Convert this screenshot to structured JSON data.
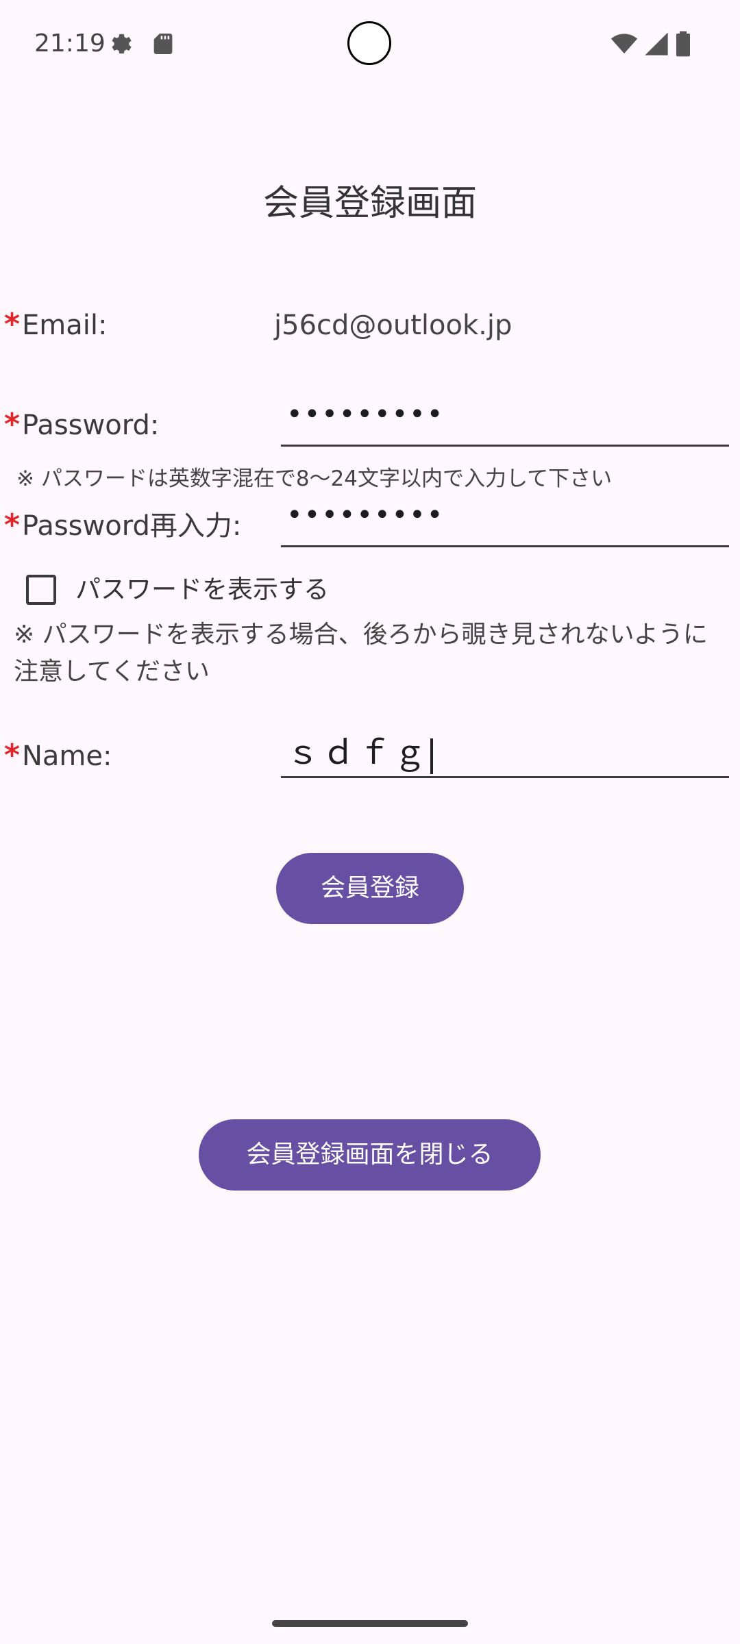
{
  "status_bar": {
    "time": "21:19",
    "icons": [
      "settings-gear-icon",
      "sd-card-icon",
      "wifi-icon",
      "cellular-signal-icon",
      "battery-icon"
    ]
  },
  "page": {
    "title": "会員登録画面"
  },
  "form": {
    "required_mark": "*",
    "email": {
      "label": "Email:",
      "value": "j56cd@outlook.jp"
    },
    "password": {
      "label": "Password:",
      "value": "•••••••••",
      "hint": "※ パスワードは英数字混在で8～24文字以内で入力して下さい"
    },
    "password_confirm": {
      "label": "Password再入力:",
      "value": "•••••••••"
    },
    "show_password": {
      "label": "パスワードを表示する",
      "checked": false
    },
    "show_password_warning": "※ パスワードを表示する場合、後ろから覗き見されないように注意してください",
    "name": {
      "label": "Name:",
      "value": "ｓｄｆｇ"
    }
  },
  "buttons": {
    "register": "会員登録",
    "close": "会員登録画面を閉じる"
  },
  "colors": {
    "background": "#FEF7FC",
    "primary": "#6750A4",
    "required": "#E0262A"
  }
}
